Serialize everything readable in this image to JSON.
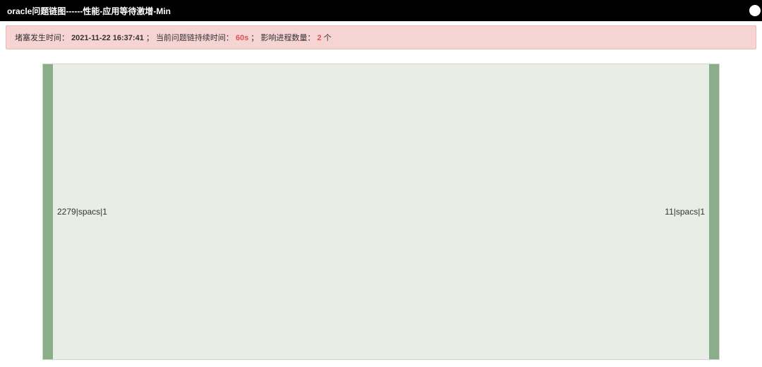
{
  "header": {
    "title": "oracle问题链图------性能-应用等待激增-Min"
  },
  "alert": {
    "label_time": "堵塞发生时间：",
    "value_time": "2021-11-22 16:37:41",
    "sep1": "；",
    "label_duration": "当前问题链持续时间：",
    "value_duration": "60s",
    "sep2": "；",
    "label_count": "影响进程数量：",
    "value_count": "2",
    "count_suffix": "个"
  },
  "chart_data": {
    "type": "sankey",
    "nodes": [
      {
        "id": "left",
        "label": "2279|spacs|1"
      },
      {
        "id": "right",
        "label": "11|spacs|1"
      }
    ],
    "links": [
      {
        "source": "left",
        "target": "right",
        "value": 1
      }
    ],
    "colors": {
      "node": "#8aae8a",
      "link": "#e8eee6"
    }
  }
}
